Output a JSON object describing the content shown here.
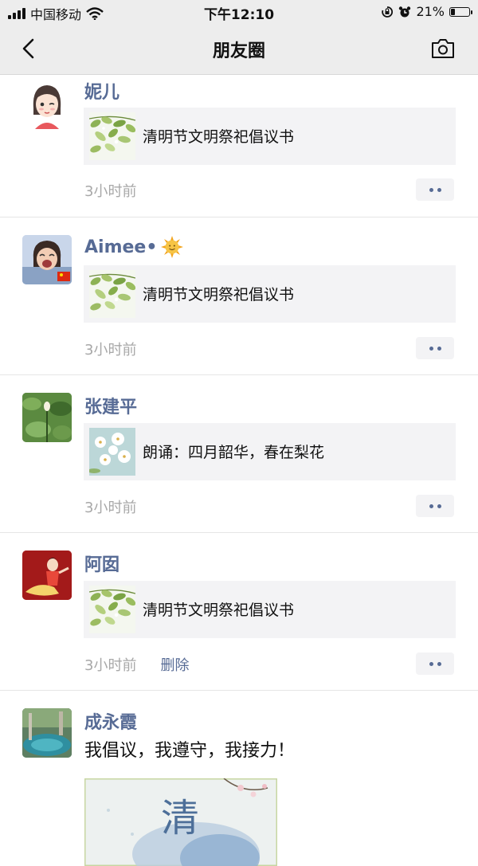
{
  "status_bar": {
    "carrier": "中国移动",
    "time": "下午12:10",
    "battery": "21%",
    "battery_level": 0.21
  },
  "nav": {
    "title": "朋友圈"
  },
  "posts": [
    {
      "name": "妮儿",
      "share_text": "清明节文明祭祀倡议书",
      "time": "3小时前"
    },
    {
      "name": "Aimee•",
      "share_text": "清明节文明祭祀倡议书",
      "time": "3小时前"
    },
    {
      "name": "张建平",
      "share_text": "朗诵：四月韶华，春在梨花",
      "time": "3小时前"
    },
    {
      "name": "阿囡",
      "share_text": "清明节文明祭祀倡议书",
      "time": "3小时前",
      "delete_label": "删除"
    },
    {
      "name": "成永霞",
      "text": "我倡议，我遵守，我接力！",
      "image_glyph": "清"
    }
  ],
  "colors": {
    "name": "#576b95",
    "bar": "#ededed",
    "card": "#f3f3f5"
  },
  "icons": [
    "back-chevron-icon",
    "camera-icon",
    "signal-icon",
    "wifi-icon",
    "lock-rotation-icon",
    "alarm-icon",
    "battery-icon",
    "sun-emoji-icon",
    "china-flag-icon",
    "more-dots-icon"
  ]
}
